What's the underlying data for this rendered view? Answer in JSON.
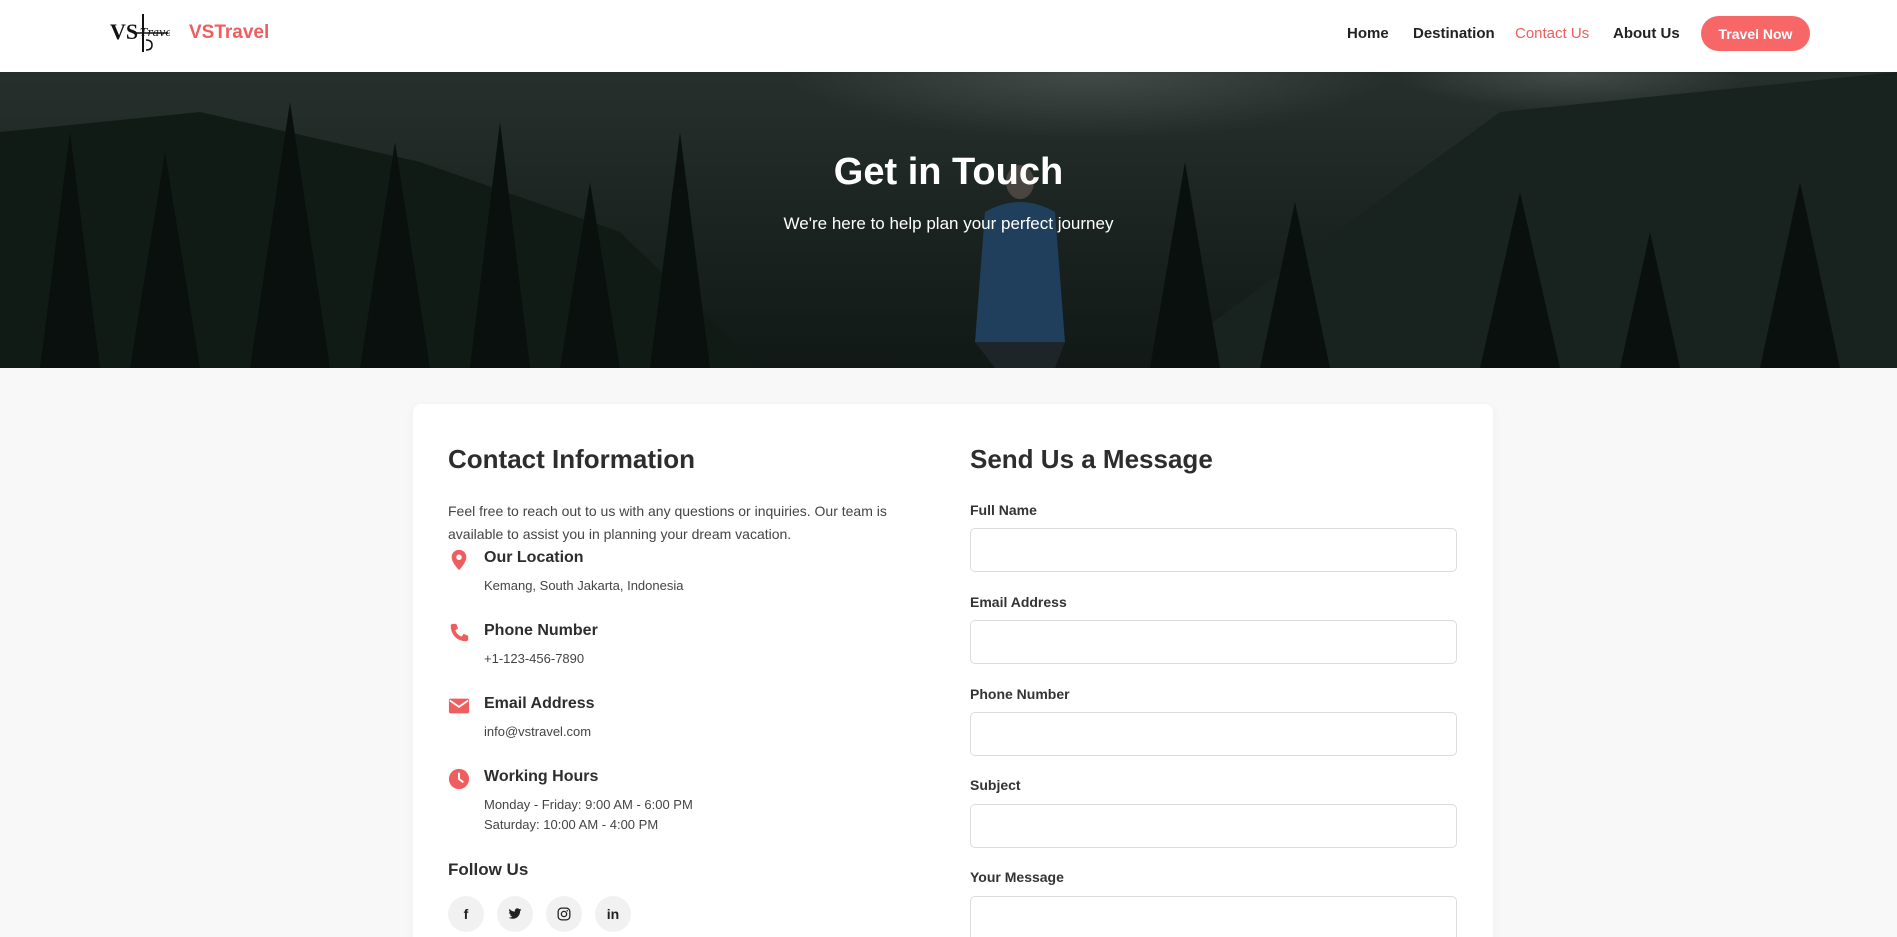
{
  "nav": {
    "brand": "VSTravel",
    "logo_text": "VS",
    "logo_script": "Travel",
    "links": [
      "Home",
      "Destination",
      "Contact Us",
      "About Us"
    ],
    "active_link": "Contact Us",
    "cta_label": "Travel Now"
  },
  "hero": {
    "title": "Get in Touch",
    "subtitle": "We're here to help plan your perfect journey"
  },
  "contact_info": {
    "heading": "Contact Information",
    "intro": "Feel free to reach out to us with any questions or inquiries. Our team is available to assist you in planning your dream vacation.",
    "items": [
      {
        "icon": "map-pin-icon",
        "title": "Our Location",
        "lines": [
          "Kemang, South Jakarta, Indonesia"
        ]
      },
      {
        "icon": "phone-icon",
        "title": "Phone Number",
        "lines": [
          "+1-123-456-7890"
        ]
      },
      {
        "icon": "envelope-icon",
        "title": "Email Address",
        "lines": [
          "info@vstravel.com"
        ]
      },
      {
        "icon": "clock-icon",
        "title": "Working Hours",
        "lines": [
          "Monday - Friday: 9:00 AM - 6:00 PM",
          "Saturday: 10:00 AM - 4:00 PM"
        ]
      }
    ],
    "follow_heading": "Follow Us",
    "socials": [
      {
        "icon": "facebook-icon",
        "glyph": "f"
      },
      {
        "icon": "twitter-icon",
        "glyph": ""
      },
      {
        "icon": "instagram-icon",
        "glyph": ""
      },
      {
        "icon": "linkedin-icon",
        "glyph": "in"
      }
    ]
  },
  "form": {
    "heading": "Send Us a Message",
    "fields": [
      {
        "label": "Full Name",
        "value": "",
        "placeholder": ""
      },
      {
        "label": "Email Address",
        "value": "",
        "placeholder": ""
      },
      {
        "label": "Phone Number",
        "value": "",
        "placeholder": ""
      },
      {
        "label": "Subject",
        "value": "",
        "placeholder": ""
      },
      {
        "label": "Your Message",
        "value": "",
        "placeholder": ""
      }
    ]
  },
  "colors": {
    "accent": "#f05d5e",
    "button": "#f76767",
    "background": "#f8f8f8"
  }
}
